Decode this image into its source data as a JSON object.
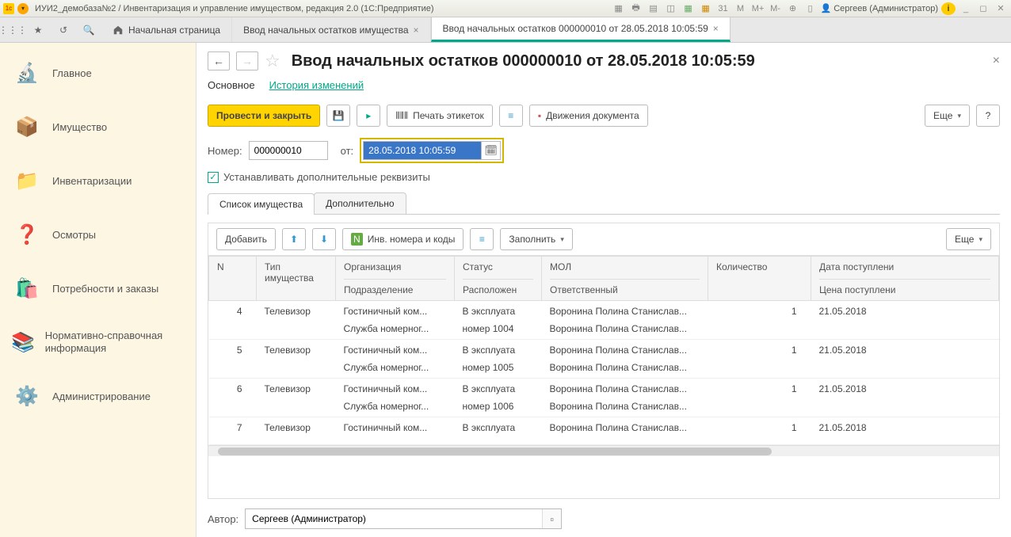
{
  "app": {
    "title": "ИУИ2_демобаза№2 / Инвентаризация и управление имуществом, редакция 2.0  (1С:Предприятие)",
    "user": "Сергеев (Администратор)"
  },
  "tabs": {
    "home": "Начальная страница",
    "t1": "Ввод начальных остатков имущества",
    "t2": "Ввод начальных остатков 000000010 от 28.05.2018 10:05:59"
  },
  "sidebar": {
    "items": [
      {
        "label": "Главное",
        "icon": "🔬"
      },
      {
        "label": "Имущество",
        "icon": "📦"
      },
      {
        "label": "Инвентаризации",
        "icon": "📁"
      },
      {
        "label": "Осмотры",
        "icon": "❓"
      },
      {
        "label": "Потребности и заказы",
        "icon": "🛍️"
      },
      {
        "label": "Нормативно-справочная информация",
        "icon": "📚"
      },
      {
        "label": "Администрирование",
        "icon": "⚙️"
      }
    ]
  },
  "page": {
    "title": "Ввод начальных остатков 000000010 от 28.05.2018 10:05:59",
    "subtabs": {
      "main": "Основное",
      "history": "История изменений"
    },
    "toolbar": {
      "post_close": "Провести и закрыть",
      "print_labels": "Печать этикеток",
      "doc_moves": "Движения документа",
      "more": "Еще"
    },
    "form": {
      "number_label": "Номер:",
      "number_value": "000000010",
      "date_label": "от:",
      "date_value": "28.05.2018 10:05:59",
      "checkbox": "Устанавливать дополнительные реквизиты"
    },
    "tabs2": {
      "list": "Список имущества",
      "extra": "Дополнительно"
    },
    "subtoolbar": {
      "add": "Добавить",
      "inv_codes": "Инв. номера и коды",
      "fill": "Заполнить",
      "more": "Еще"
    },
    "columns": {
      "n": "N",
      "type": "Тип имущества",
      "org": "Организация",
      "org_sub": "Подразделение",
      "status": "Статус",
      "status_sub": "Расположен",
      "mol": "МОЛ",
      "mol_sub": "Ответственный",
      "qty": "Количество",
      "date": "Дата поступлени",
      "date_sub": "Цена поступлени"
    },
    "rows": [
      {
        "n": "4",
        "type": "Телевизор",
        "org": "Гостиничный ком...",
        "org_sub": "Служба номерног...",
        "status": "В эксплуата",
        "status_sub": "номер 1004",
        "mol": "Воронина Полина Станислав...",
        "mol_sub": "Воронина Полина Станислав...",
        "qty": "1",
        "date": "21.05.2018"
      },
      {
        "n": "5",
        "type": "Телевизор",
        "org": "Гостиничный ком...",
        "org_sub": "Служба номерног...",
        "status": "В эксплуата",
        "status_sub": "номер 1005",
        "mol": "Воронина Полина Станислав...",
        "mol_sub": "Воронина Полина Станислав...",
        "qty": "1",
        "date": "21.05.2018"
      },
      {
        "n": "6",
        "type": "Телевизор",
        "org": "Гостиничный ком...",
        "org_sub": "Служба номерног...",
        "status": "В эксплуата",
        "status_sub": "номер 1006",
        "mol": "Воронина Полина Станислав...",
        "mol_sub": "Воронина Полина Станислав...",
        "qty": "1",
        "date": "21.05.2018"
      },
      {
        "n": "7",
        "type": "Телевизор",
        "org": "Гостиничный ком...",
        "org_sub": "",
        "status": "В эксплуата",
        "status_sub": "",
        "mol": "Воронина Полина Станислав...",
        "mol_sub": "",
        "qty": "1",
        "date": "21.05.2018"
      }
    ],
    "author_label": "Автор:",
    "author_value": "Сергеев (Администратор)"
  }
}
